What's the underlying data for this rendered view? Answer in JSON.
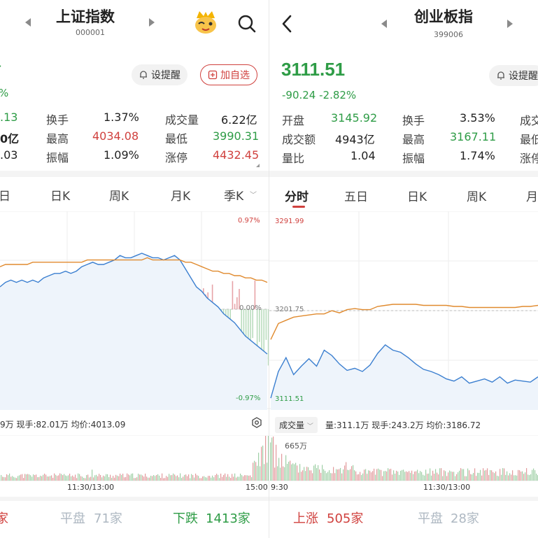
{
  "left": {
    "header": {
      "name": "上证指数",
      "code": "000001"
    },
    "price_partial": "%",
    "buttons": {
      "alert": "设提醒",
      "add_watch": "加自选"
    },
    "stats": [
      {
        "partial": ".13",
        "label": "换手",
        "value": "1.37%",
        "label2": "成交量",
        "value2": "6.22亿"
      },
      {
        "partial": "0亿",
        "label": "最高",
        "value": "4034.08",
        "label2": "最低",
        "value2": "3990.31"
      },
      {
        "partial": ".03",
        "label": "振幅",
        "value": "1.09%",
        "label2": "涨停",
        "value2": "4432.45"
      }
    ],
    "tabs": [
      "日",
      "日K",
      "周K",
      "月K",
      "季K"
    ],
    "chart_labels": {
      "top_pct": "0.97%",
      "mid_pct": "0.00%",
      "bottom_pct": "-0.97%"
    },
    "info_line": "9万  现手:82.01万  均价:4013.09",
    "times": {
      "mid": "11:30/13:00",
      "end": "15:00"
    },
    "breadth": {
      "up_partial": "家",
      "flat": "平盘",
      "flat_count": "71家",
      "down": "下跌",
      "down_count": "1413家"
    },
    "chart_data": [
      {
        "type": "line",
        "title": "",
        "series": [
          {
            "name": "",
            "color": "#3b7fd0",
            "values": [
              10,
              12,
              13,
              12,
              13,
              12,
              13,
              12,
              14,
              15,
              16,
              16,
              17,
              16,
              17,
              19,
              20,
              21,
              20,
              20,
              21,
              22,
              24,
              23,
              23,
              24,
              25,
              24,
              23,
              23,
              22,
              23,
              24,
              22,
              18,
              14,
              10,
              8,
              5,
              3,
              1,
              -2,
              -4,
              -6,
              -9,
              -12,
              -14,
              -16,
              -18,
              -20
            ]
          },
          {
            "name": "",
            "color": "#e08a2e",
            "values": [
              19,
              20,
              20,
              20,
              20,
              20,
              21,
              21,
              21,
              21,
              21,
              21,
              21,
              21,
              21,
              21,
              22,
              22,
              22,
              22,
              22,
              22,
              22,
              22,
              22,
              22,
              22,
              23,
              22,
              22,
              22,
              22,
              22,
              22,
              21,
              21,
              20,
              19,
              18,
              17,
              17,
              16,
              16,
              15,
              15,
              14,
              14,
              13,
              13,
              12
            ]
          }
        ]
      }
    ]
  },
  "right": {
    "header": {
      "name": "创业板指",
      "code": "399006"
    },
    "price": "3111.51",
    "change": "-90.24  -2.82%",
    "buttons": {
      "alert": "设提醒"
    },
    "stats": [
      {
        "label": "开盘",
        "value": "3145.92",
        "label2": "换手",
        "value2": "3.53%",
        "label3": "成交"
      },
      {
        "label": "成交额",
        "value": "4943亿",
        "label2": "最高",
        "value2": "3167.11",
        "label3": "最低"
      },
      {
        "label": "量比",
        "value": "1.04",
        "label2": "振幅",
        "value2": "1.74%",
        "label3": "涨停"
      }
    ],
    "tabs": [
      "分时",
      "五日",
      "日K",
      "周K",
      "月"
    ],
    "chart_labels": {
      "top": "3291.99",
      "mid": "3201.75",
      "bottom": "3111.51"
    },
    "vol_select": "成交量",
    "info_line": "量:311.1万  现手:243.2万  均价:3186.72",
    "vol_max": "665万",
    "times": {
      "start": "9:30",
      "mid": "11:30/13:00"
    },
    "breadth": {
      "up": "上涨",
      "up_count": "505家",
      "flat": "平盘",
      "flat_count": "28家"
    },
    "chart_data": [
      {
        "type": "line",
        "title": "",
        "ylim": [
          3111.51,
          3291.99
        ],
        "series": [
          {
            "name": "",
            "color": "#3b7fd0",
            "values": [
              3120,
              3145,
              3158,
              3142,
              3150,
              3157,
              3150,
              3165,
              3160,
              3152,
              3146,
              3148,
              3145,
              3151,
              3162,
              3170,
              3165,
              3163,
              3158,
              3152,
              3147,
              3145,
              3142,
              3138,
              3136,
              3140,
              3134,
              3136,
              3138,
              3135,
              3140,
              3134,
              3137,
              3136,
              3135,
              3140
            ]
          },
          {
            "name": "",
            "color": "#e08a2e",
            "values": [
              3175,
              3190,
              3193,
              3196,
              3197,
              3198,
              3199,
              3199,
              3202,
              3200,
              3203,
              3204,
              3203,
              3203,
              3206,
              3207,
              3208,
              3208,
              3208,
              3208,
              3207,
              3207,
              3207,
              3207,
              3206,
              3206,
              3205,
              3205,
              3205,
              3205,
              3205,
              3205,
              3205,
              3206,
              3206,
              3207
            ]
          }
        ]
      }
    ]
  },
  "colors": {
    "up": "#d0413e",
    "down": "#2e9c46",
    "price_line": "#3b7fd0",
    "avg_line": "#e08a2e"
  }
}
